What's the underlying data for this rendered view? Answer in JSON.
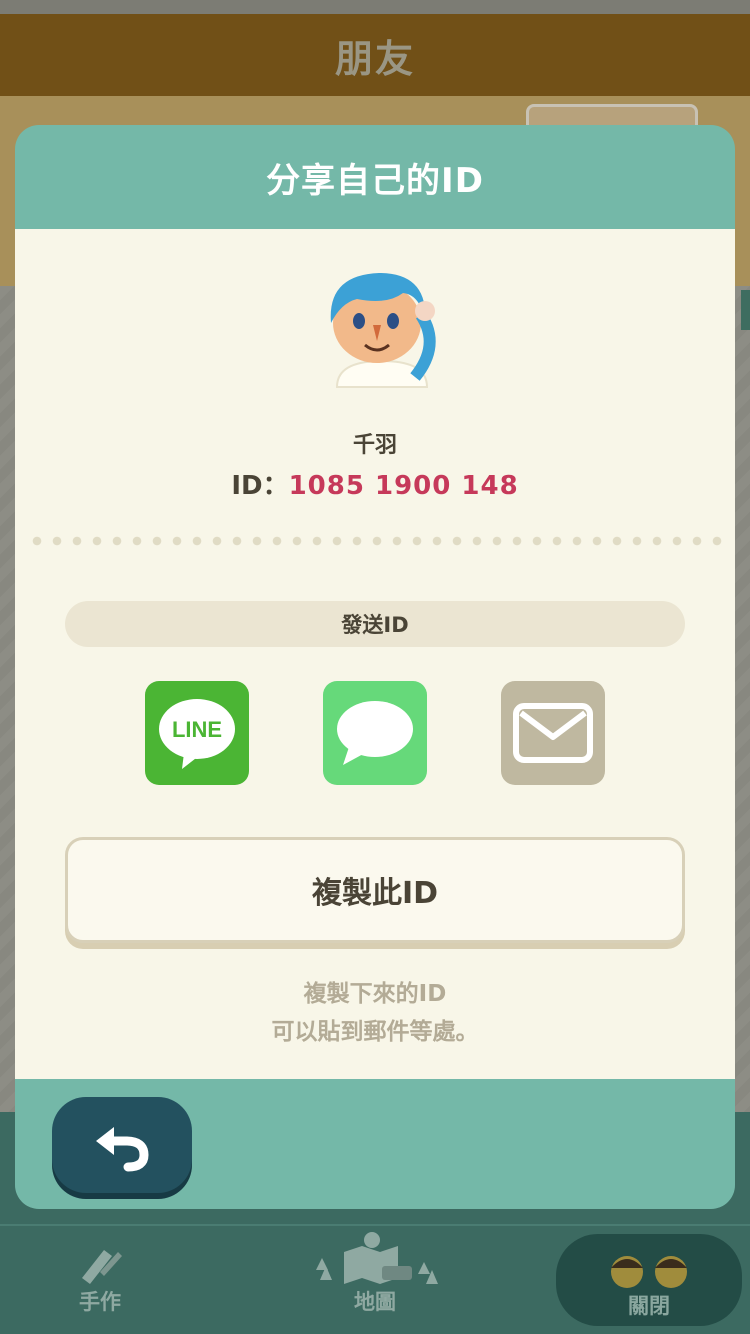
{
  "background": {
    "header_title": "朋友",
    "nav": {
      "craft_label": "手作",
      "map_label": "地圖",
      "close_label": "關閉"
    }
  },
  "modal": {
    "title": "分享自己的ID",
    "player_name": "千羽",
    "id_prefix": "ID：",
    "id_value": "1085 1900 148",
    "send_label": "發送ID",
    "share_buttons": [
      {
        "service": "LINE",
        "icon": "line-icon",
        "text": "LINE",
        "color": "#4bb534"
      },
      {
        "service": "Messages",
        "icon": "speech-bubble-icon",
        "color": "#66d97a"
      },
      {
        "service": "Mail",
        "icon": "envelope-icon",
        "color": "#bfb8a0"
      }
    ],
    "copy_label": "複製此ID",
    "hint_line1": "複製下來的ID",
    "hint_line2": "可以貼到郵件等處。"
  },
  "colors": {
    "modal_frame": "#74b8a8",
    "modal_body": "#f8f6e8",
    "id_accent": "#c6395a",
    "back_button": "#23515f"
  }
}
